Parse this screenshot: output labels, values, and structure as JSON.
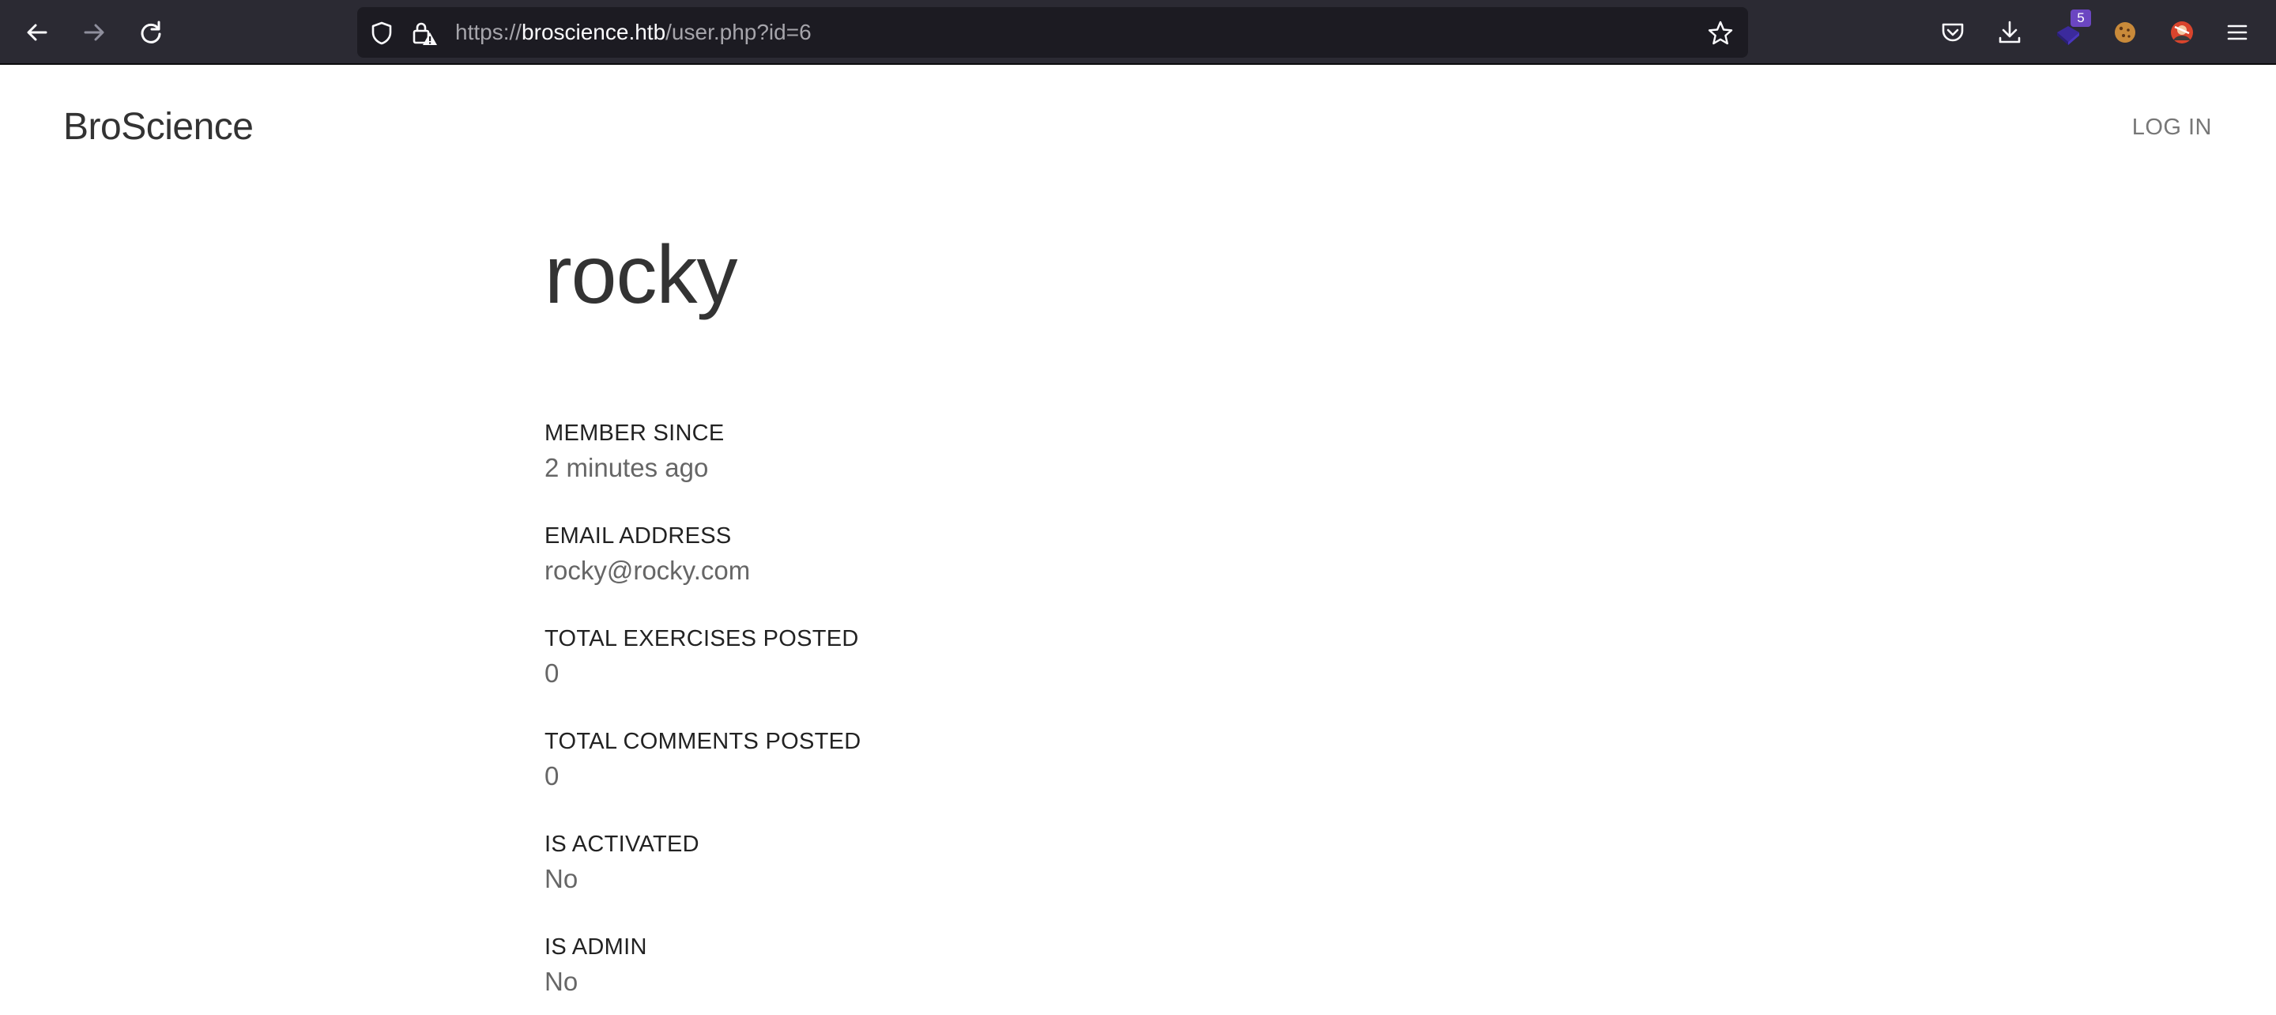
{
  "browser": {
    "url_scheme": "https://",
    "url_host": "broscience.htb",
    "url_path": "/user.php?id=6",
    "extension_badge_count": "5",
    "icons": {
      "back": "arrow-left-icon",
      "forward": "arrow-right-icon",
      "reload": "reload-icon",
      "tracking_protection": "shield-icon",
      "security": "lock-warning-icon",
      "bookmark": "star-icon",
      "pocket": "pocket-icon",
      "downloads": "download-icon",
      "extension_1": "extension-icon",
      "extension_2": "cookie-icon",
      "extension_3": "avatar-extension-icon",
      "menu": "hamburger-menu-icon"
    }
  },
  "site": {
    "brand": "BroScience",
    "login_label": "LOG IN"
  },
  "profile": {
    "username": "rocky",
    "fields": [
      {
        "label": "MEMBER SINCE",
        "value": "2 minutes ago"
      },
      {
        "label": "EMAIL ADDRESS",
        "value": "rocky@rocky.com"
      },
      {
        "label": "TOTAL EXERCISES POSTED",
        "value": "0"
      },
      {
        "label": "TOTAL COMMENTS POSTED",
        "value": "0"
      },
      {
        "label": "IS ACTIVATED",
        "value": "No"
      },
      {
        "label": "IS ADMIN",
        "value": "No"
      }
    ]
  },
  "colors": {
    "toolbar_bg": "#2b2a33",
    "urlbar_bg": "#1c1b22",
    "badge": "#6b46c1",
    "text_dark": "#333333",
    "text_muted": "#666666"
  }
}
